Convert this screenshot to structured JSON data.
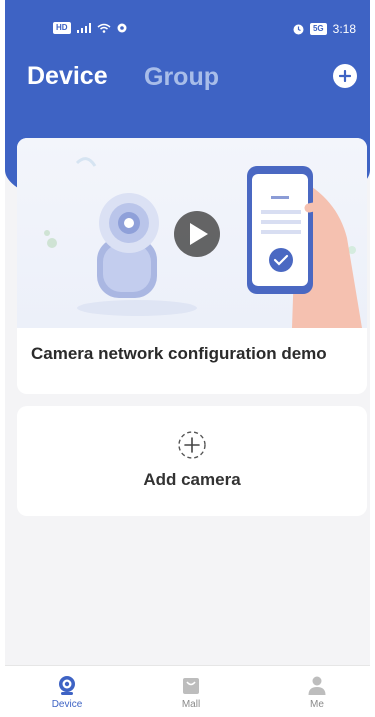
{
  "status_bar": {
    "sim_badge": "HD",
    "battery": "5G",
    "time": "3:18"
  },
  "header": {
    "tab_device": "Device",
    "tab_group": "Group"
  },
  "demo_card": {
    "title": "Camera network configuration demo"
  },
  "add_card": {
    "label": "Add camera"
  },
  "bottom_nav": {
    "items": [
      {
        "label": "Device"
      },
      {
        "label": "Mall"
      },
      {
        "label": "Me"
      }
    ]
  },
  "colors": {
    "primary": "#3e63c4",
    "background": "#f4f4f6",
    "text": "#2b2b2b"
  }
}
